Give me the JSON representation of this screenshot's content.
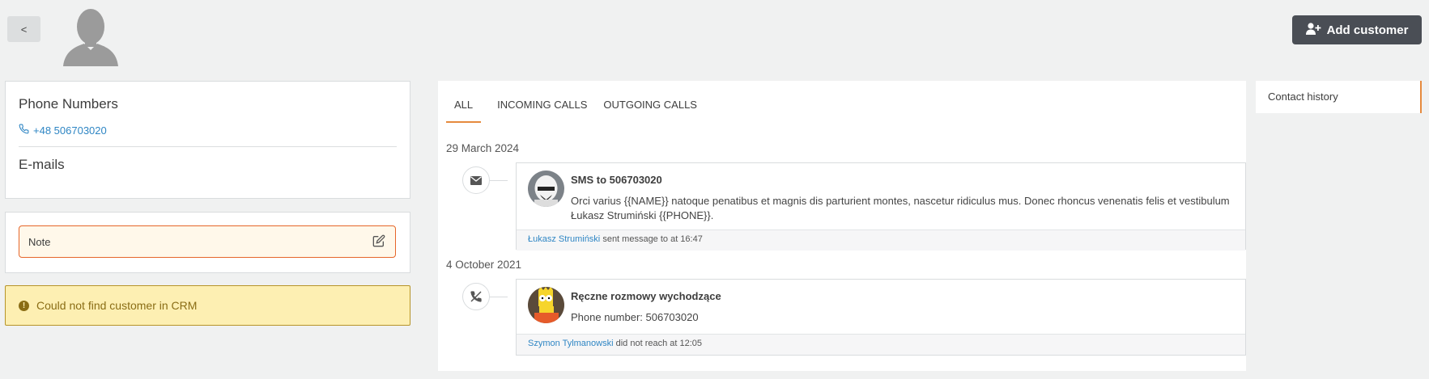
{
  "header": {
    "back_label": "<",
    "add_customer_label": "Add customer"
  },
  "contact": {
    "phone_numbers_title": "Phone Numbers",
    "phone": "+48 506703020",
    "emails_title": "E-mails"
  },
  "note": {
    "label": "Note"
  },
  "warning": {
    "text": "Could not find customer in CRM"
  },
  "history": {
    "tabs": [
      {
        "label": "ALL"
      },
      {
        "label": "INCOMING CALLS"
      },
      {
        "label": "OUTGOING CALLS"
      }
    ],
    "groups": [
      {
        "date": "29 March 2024",
        "icon": "envelope-icon",
        "title": "SMS to 506703020",
        "text": "Orci varius {{NAME}} natoque penatibus et magnis dis parturient montes, nascetur ridiculus mus. Donec rhoncus venenatis felis et vestibulum Łukasz Strumiński {{PHONE}}.",
        "user": "Łukasz Strumiński",
        "footer_text": " sent message to at 16:47"
      },
      {
        "date": "4 October 2021",
        "icon": "phone-missed-icon",
        "title": "Ręczne rozmowy wychodzące",
        "text": "Phone number: 506703020",
        "user": "Szymon Tylmanowski",
        "footer_text": " did not reach at 12:05"
      }
    ]
  },
  "side_panel": {
    "label": "Contact history"
  },
  "colors": {
    "accent": "#e68a3e",
    "link": "#2f86c4",
    "warning_bg": "#fdefb2",
    "note_border": "#e6662a",
    "button_dark": "#4a4e55"
  }
}
